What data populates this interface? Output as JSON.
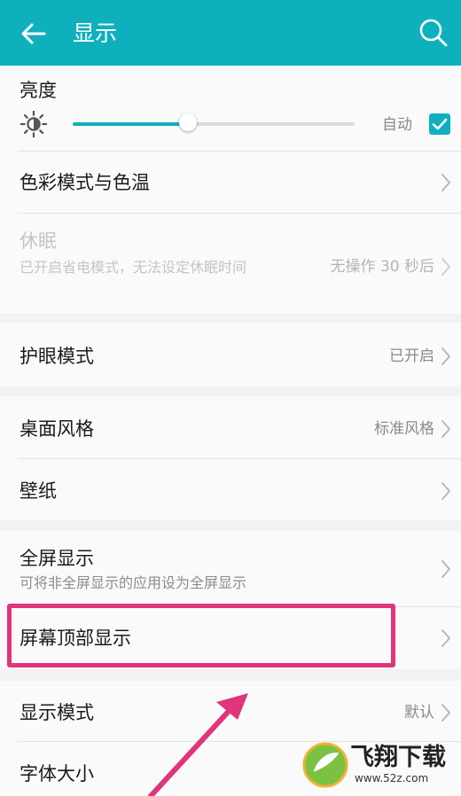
{
  "header": {
    "title": "显示"
  },
  "brightness": {
    "label": "亮度",
    "level_fraction": 0.41,
    "auto_label": "自动",
    "auto_checked": true
  },
  "rows": {
    "color_mode": {
      "title": "色彩模式与色温"
    },
    "sleep": {
      "title": "休眠",
      "subtitle": "已开启省电模式，无法设定休眠时间",
      "value": "无操作 30 秒后",
      "enabled": false
    },
    "eye_comfort": {
      "title": "护眼模式",
      "value": "已开启"
    },
    "home_style": {
      "title": "桌面风格",
      "value": "标准风格"
    },
    "wallpaper": {
      "title": "壁纸"
    },
    "full_screen": {
      "title": "全屏显示",
      "subtitle": "可将非全屏显示的应用设为全屏显示"
    },
    "top_display": {
      "title": "屏幕顶部显示"
    },
    "display_mode": {
      "title": "显示模式",
      "value": "默认"
    },
    "font_size": {
      "title": "字体大小"
    }
  },
  "annotation": {
    "highlight_color": "#e0347c",
    "arrow_color": "#e0347c"
  },
  "watermark": {
    "brand": "飞翔下载",
    "url": "www.52z.com"
  },
  "colors": {
    "accent": "#0fb0bd",
    "background": "#f2f2f2",
    "card": "#fafafa"
  }
}
